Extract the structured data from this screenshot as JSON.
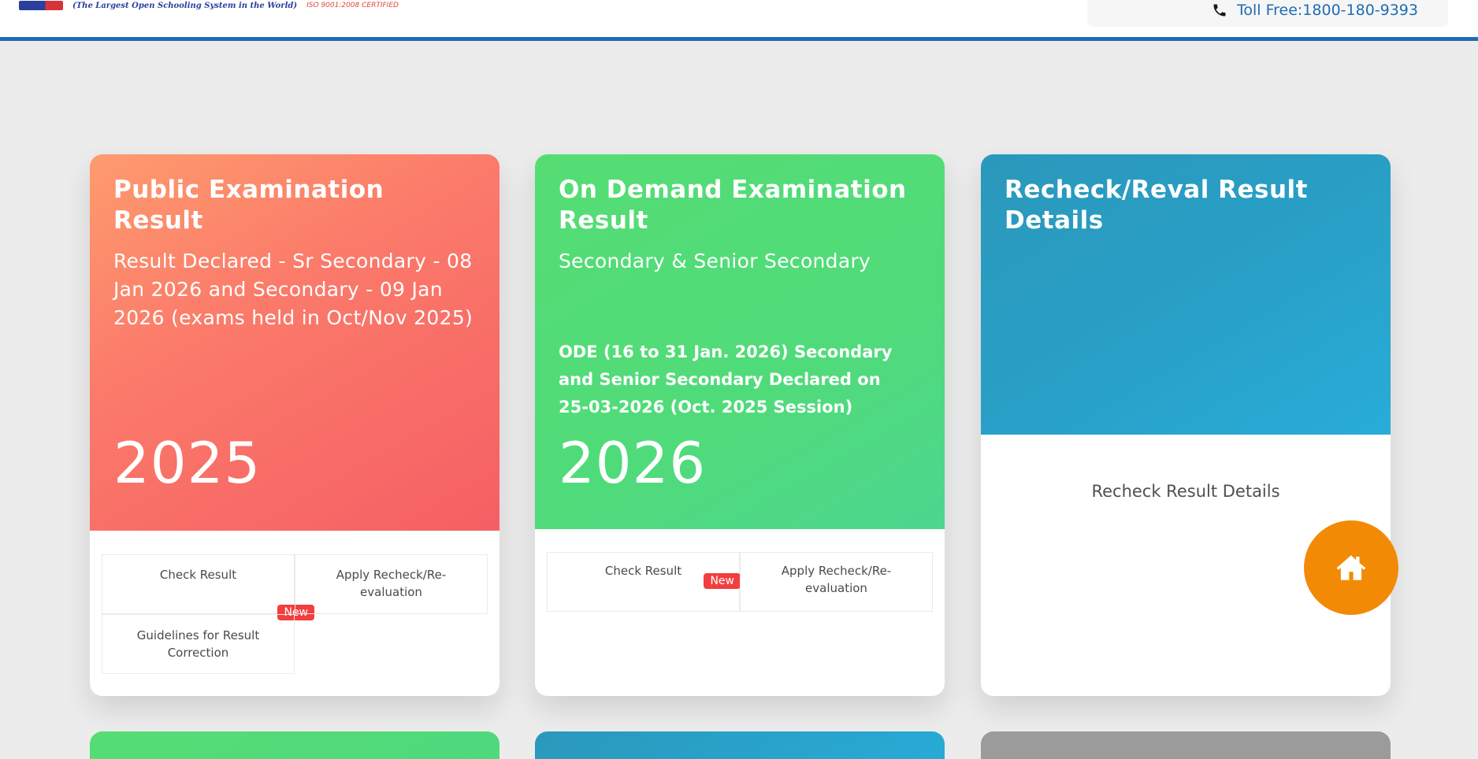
{
  "header": {
    "logo_tagline": "(The Largest Open Schooling System in the World)",
    "logo_iso": "ISO 9001:2008 CERTIFIED",
    "toll_free": "Toll Free:1800-180-9393"
  },
  "cards": [
    {
      "title": "Public Examination Result",
      "subtitle": "Result Declared - Sr Secondary - 08 Jan 2026 and Secondary - 09 Jan 2026 (exams held in Oct/Nov 2025)",
      "year": "2025",
      "links": [
        "Check Result",
        "Apply Recheck/Re-evaluation",
        "Guidelines for Result Correction"
      ],
      "badge": "New"
    },
    {
      "title": "On Demand Examination Result",
      "subtitle": "Secondary & Senior Secondary",
      "note": "ODE (16 to 31 Jan. 2026) Secondary and Senior Secondary Declared on 25-03-2026 (Oct. 2025 Session)",
      "year": "2026",
      "links": [
        "Check Result",
        "Apply Recheck/Re-evaluation"
      ],
      "badge": "New"
    },
    {
      "title": "Recheck/Reval Result Details",
      "link": "Recheck Result Details"
    }
  ],
  "colors": {
    "header_border": "#1e6db4",
    "card1": "#f8735f",
    "card2": "#50db7a",
    "card3": "#299fc6",
    "home_button": "#f38a05",
    "badge": "#f23e3e"
  },
  "icons": {
    "phone": "phone-icon",
    "home": "home-icon"
  }
}
